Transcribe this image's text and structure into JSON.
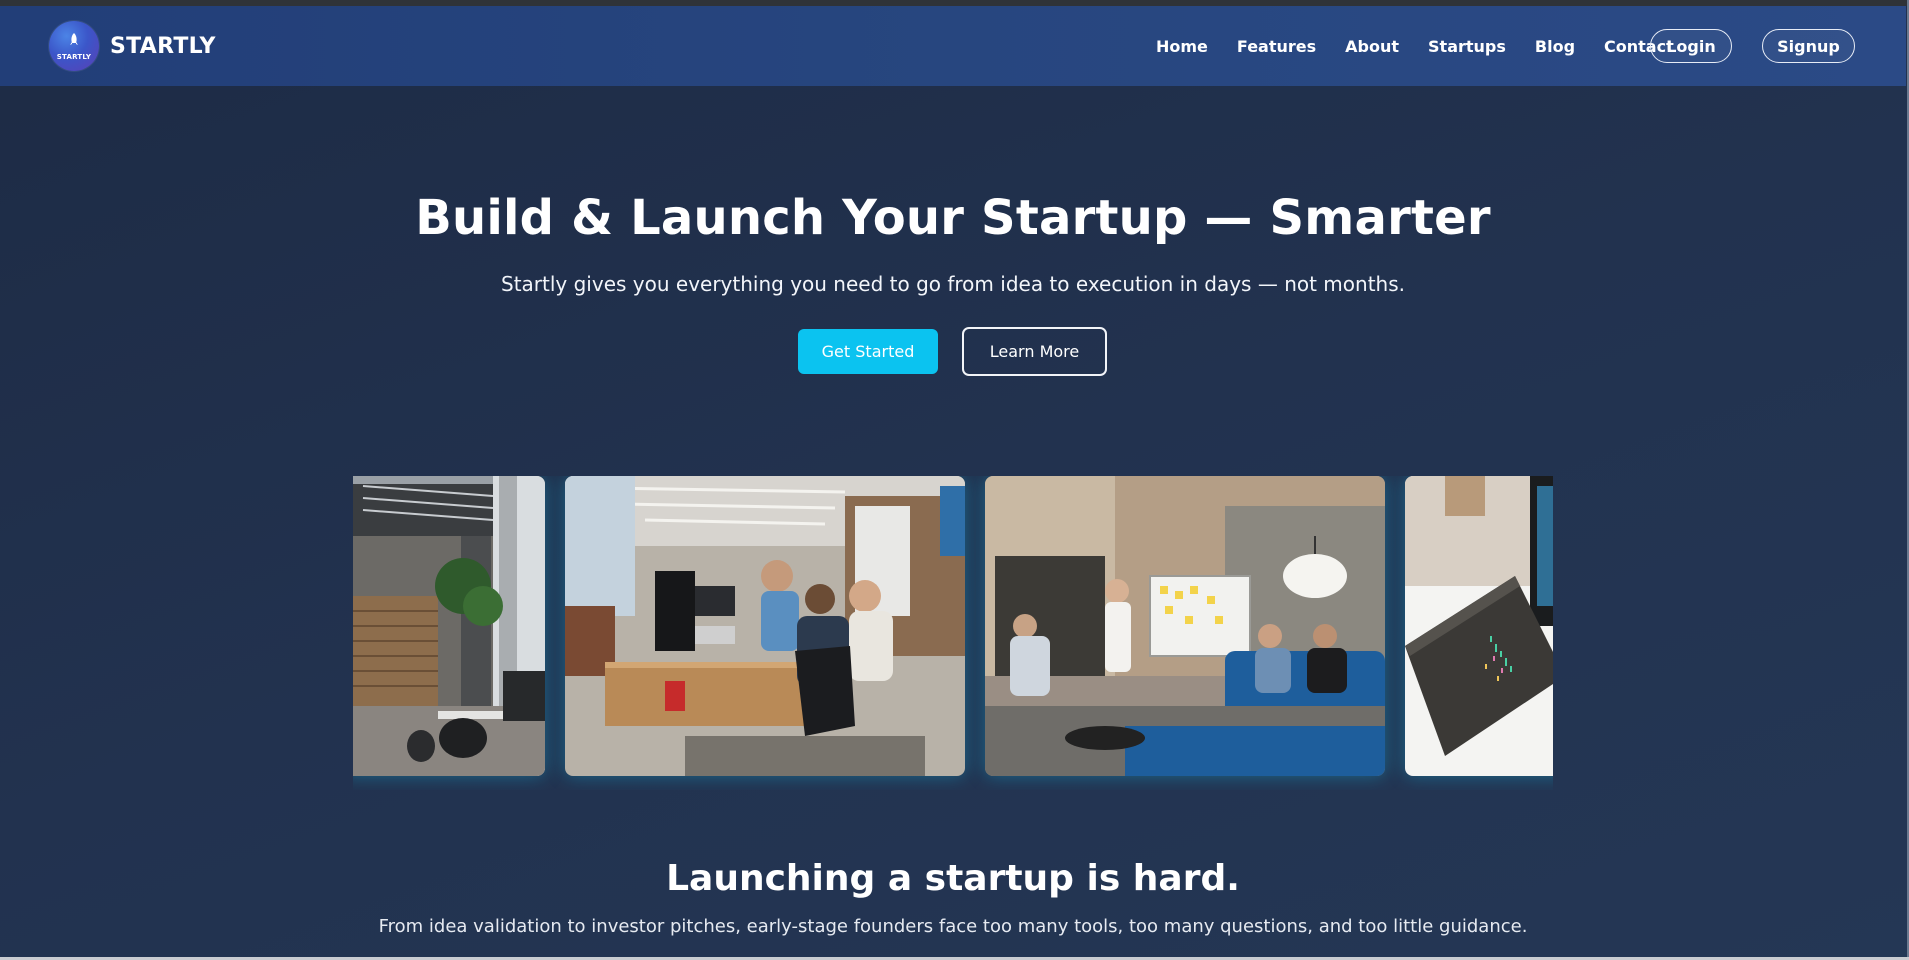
{
  "brand": {
    "logo_text": "STARTLY",
    "name": "STARTLY"
  },
  "nav": {
    "links": [
      "Home",
      "Features",
      "About",
      "Startups",
      "Blog",
      "Contact"
    ],
    "login": "Login",
    "signup": "Signup"
  },
  "hero": {
    "title": "Build & Launch Your Startup — Smarter",
    "subtitle": "Startly gives you everything you need to go from idea to execution in days — not months.",
    "primary_cta": "Get Started",
    "secondary_cta": "Learn More"
  },
  "carousel": {
    "images": [
      "office-staircase-image",
      "team-desk-meeting-image",
      "whiteboard-brainstorm-image",
      "laptop-book-image"
    ]
  },
  "problem": {
    "title": "Launching a startup is hard.",
    "subtitle": "From idea validation to investor pitches, early-stage founders face too many tools, too many questions, and too little guidance."
  },
  "colors": {
    "background": "#1d2b45",
    "navbar": "#223e78",
    "accent": "#0bc3f0"
  }
}
